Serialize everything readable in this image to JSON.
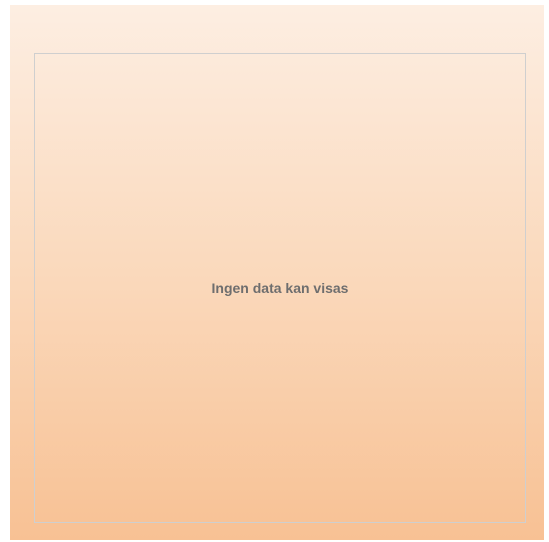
{
  "chart": {
    "empty_message": "Ingen data kan visas"
  },
  "colors": {
    "background_top": "#fdeee2",
    "background_bottom": "#f8c194",
    "frame_border": "#cfcfcf",
    "message_text": "#6e6e6e"
  }
}
